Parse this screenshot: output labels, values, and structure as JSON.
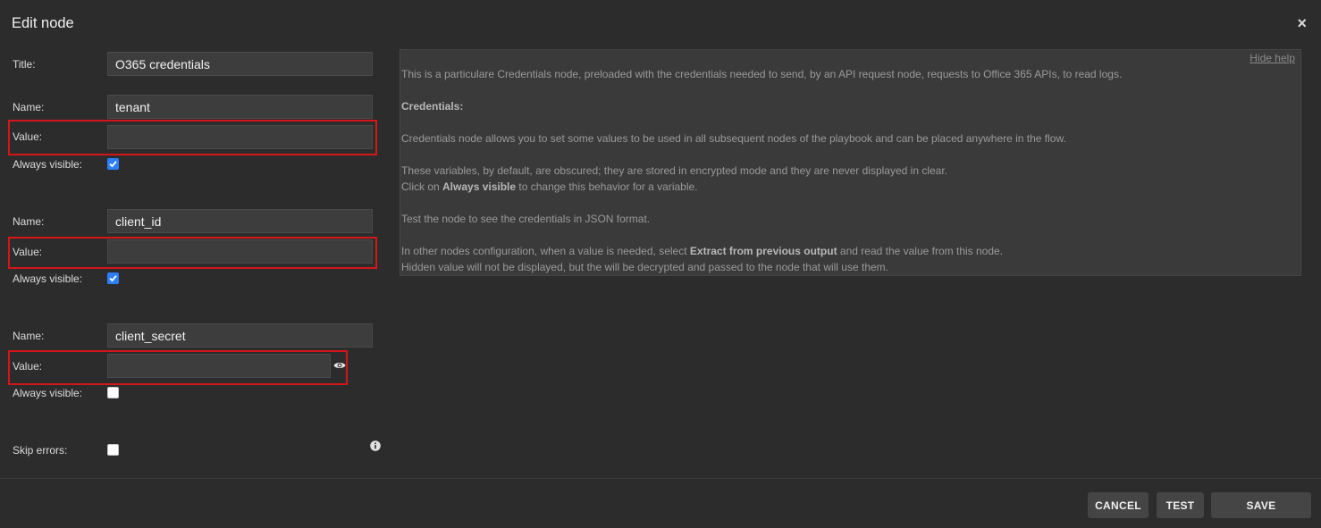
{
  "dialog": {
    "title": "Edit node",
    "close_label": "×"
  },
  "form": {
    "title_label": "Title:",
    "title_value": "O365 credentials",
    "variables": [
      {
        "name_label": "Name:",
        "name": "tenant",
        "value_label": "Value:",
        "value": "",
        "always_label": "Always visible:",
        "always_visible": true
      },
      {
        "name_label": "Name:",
        "name": "client_id",
        "value_label": "Value:",
        "value": "",
        "always_label": "Always visible:",
        "always_visible": true
      },
      {
        "name_label": "Name:",
        "name": "client_secret",
        "value_label": "Value:",
        "value": "",
        "always_label": "Always visible:",
        "always_visible": false
      }
    ],
    "skip_errors_label": "Skip errors:",
    "skip_errors": false
  },
  "help": {
    "hide_label": "Hide help",
    "p1": "This is a particulare Credentials node, preloaded with the credentials needed to send, by an API request node, requests to Office 365 APIs, to read logs.",
    "heading": "Credentials:",
    "p2": "Credentials node allows you to set some values to be used in all subsequent nodes of the playbook and can be placed anywhere in the flow.",
    "p3a": "These variables, by default, are obscured; they are stored in encrypted mode and they are never displayed in clear.",
    "p3b_pre": "Click on ",
    "p3b_bold": "Always visible",
    "p3b_post": " to change this behavior for a variable.",
    "p4": "Test the node to see the credentials in JSON format.",
    "p5_pre": "In other nodes configuration, when a value is needed, select ",
    "p5_bold": "Extract from previous output",
    "p5_post": " and read the value from this node.",
    "p6": "Hidden value will not be displayed, but the will be decrypted and passed to the node that will use them."
  },
  "footer": {
    "cancel": "CANCEL",
    "test": "TEST",
    "save": "SAVE"
  },
  "colors": {
    "highlight": "#d4151a",
    "checkbox_checked": "#2d7ff9"
  }
}
